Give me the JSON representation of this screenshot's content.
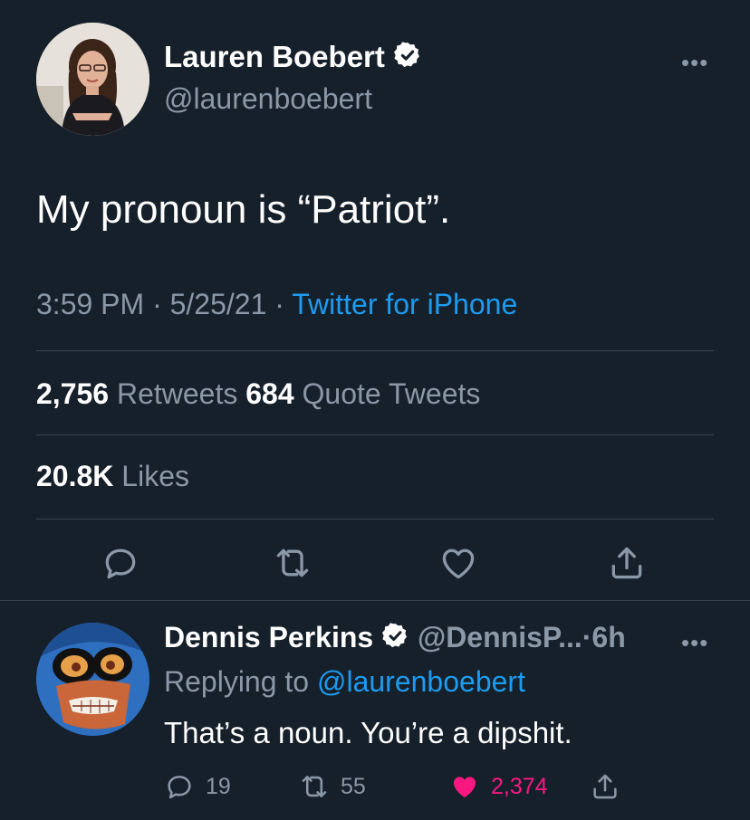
{
  "colors": {
    "background": "#15202b",
    "text": "#ffffff",
    "secondary": "#8b98a5",
    "link": "#1d9bf0",
    "verified": "#ffffff",
    "like": "#f91880",
    "divider": "#38444d"
  },
  "tweet": {
    "author": {
      "display_name": "Lauren Boebert",
      "handle": "@laurenboebert",
      "verified_icon": "verified-badge-icon"
    },
    "text": "My pronoun is “Patriot”.",
    "time": "3:59 PM",
    "date": "5/25/21",
    "separator": "·",
    "source": "Twitter for iPhone",
    "stats": {
      "retweets_count": "2,756",
      "retweets_label": "Retweets",
      "quotes_count": "684",
      "quotes_label": "Quote Tweets",
      "likes_count": "20.8K",
      "likes_label": "Likes"
    },
    "actions": [
      "reply-icon",
      "retweet-icon",
      "like-icon",
      "share-icon"
    ],
    "more_label": "•••"
  },
  "reply": {
    "author": {
      "display_name": "Dennis Perkins",
      "handle": "@DennisP...",
      "verified_icon": "verified-badge-icon"
    },
    "age": "6h",
    "separator": "·",
    "replying_label": "Replying to",
    "replying_to": "@laurenboebert",
    "text": "That’s a noun. You’re a dipshit.",
    "reply_count": "19",
    "retweet_count": "55",
    "like_count": "2,374",
    "liked": true,
    "more_label": "•••"
  }
}
